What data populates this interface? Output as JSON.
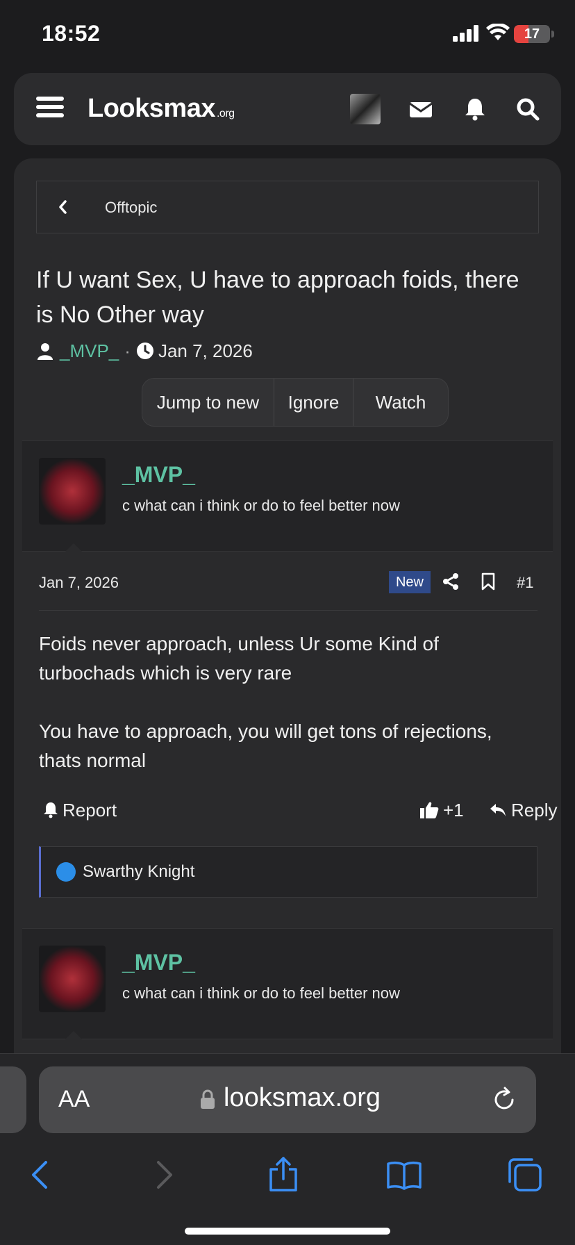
{
  "status_bar": {
    "time": "18:52",
    "battery": "17"
  },
  "header": {
    "logo_main": "Looksmax",
    "logo_suffix": ".org"
  },
  "breadcrumb": {
    "label": "Offtopic"
  },
  "thread": {
    "title": "If U want Sex, U have to approach foids, there is No Other way",
    "author": "_MVP_",
    "date": "Jan 7, 2026",
    "buttons": [
      "Jump to new",
      "Ignore",
      "Watch"
    ]
  },
  "posts": [
    {
      "username": "_MVP_",
      "user_title": "c what can i think or do to feel better now",
      "date": "Jan 7, 2026",
      "badge": "New",
      "number": "#1",
      "body": [
        "Foids never approach, unless Ur some Kind of turbochads which is very rare",
        "You have to approach, you will get tons of rejections, thats normal"
      ],
      "report_label": "Report",
      "like_count": "+1",
      "reply_label": "Reply",
      "reactions_by": "Swarthy Knight"
    },
    {
      "username": "_MVP_",
      "user_title": "c what can i think or do to feel better now"
    }
  ],
  "safari": {
    "aa_label": "AA",
    "url": "looksmax.org"
  },
  "colors": {
    "accent": "#5ec2a3",
    "badge": "#2f4a8a",
    "safari_blue": "#3b8ff5"
  }
}
